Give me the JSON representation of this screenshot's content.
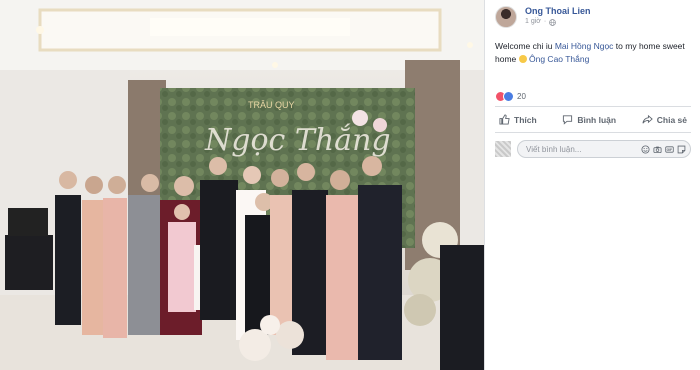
{
  "post": {
    "author": "Ong Thoai Lien",
    "time": "1 giờ",
    "text_prefix": "Welcome chi iu ",
    "mention_1": "Mai Hồng Ngọc",
    "text_middle": " to my home sweet home ",
    "mention_2": "Ông Cao Thắng",
    "reaction_count": "20"
  },
  "actions": {
    "like": "Thích",
    "comment": "Bình luận",
    "share": "Chia sẻ"
  },
  "comment": {
    "placeholder": "Viết bình luận..."
  },
  "photo": {
    "backdrop_text": "Ngọc Thắng",
    "banner_text": "TRÂU QUY"
  },
  "colors": {
    "link": "#385898",
    "text": "#1d2129",
    "muted": "#606770",
    "accent_pink": "#f25268",
    "accent_blue": "#4a7de2"
  }
}
